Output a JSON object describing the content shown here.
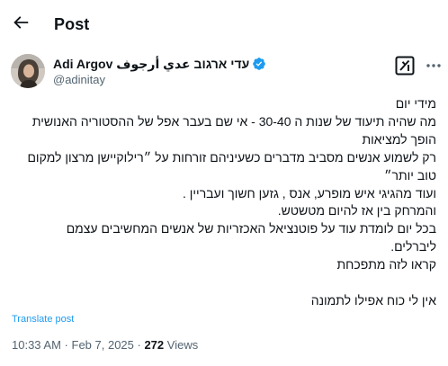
{
  "header": {
    "title": "Post",
    "back_icon": "arrow-left-icon"
  },
  "author": {
    "display_name": "Adi Argov עדי ארגוב عدي أرجوف",
    "handle": "@adinitay",
    "verified_icon": "verified-badge-icon",
    "verified_color": "#1d9bf0",
    "grok_icon": "grok-icon",
    "more_icon": "more-icon"
  },
  "tweet": {
    "lines": [
      "מידי יום",
      "מה שהיה תיעוד של שנות ה 30-40 - אי שם בעבר אפל של ההסטוריה האנושית",
      "הופך למציאות",
      "רק לשמוע אנשים מסביב מדברים כשעיניהם זורחות על ״רילוקיישן מרצון למקום",
      "טוב יותר״",
      "ועוד מהגיגי איש מופרע, אנס , גזען חשוך ועבריין .",
      "והמרחק בין אז להיום מטשטש.",
      "בכל יום לומדת עוד על פוטנציאל האכזריות של אנשים המחשיבים עצמם",
      "ליברלים.",
      "קראו לזה מתפכחת",
      "",
      "אין לי כוח אפילו לתמונה"
    ]
  },
  "translate_label": "Translate post",
  "meta": {
    "time": "10:33 AM",
    "separator": " · ",
    "date": "Feb 7, 2025",
    "views_count": "272",
    "views_label": " Views"
  },
  "colors": {
    "text": "#0f1419",
    "secondary": "#536471",
    "accent": "#1d9bf0"
  }
}
